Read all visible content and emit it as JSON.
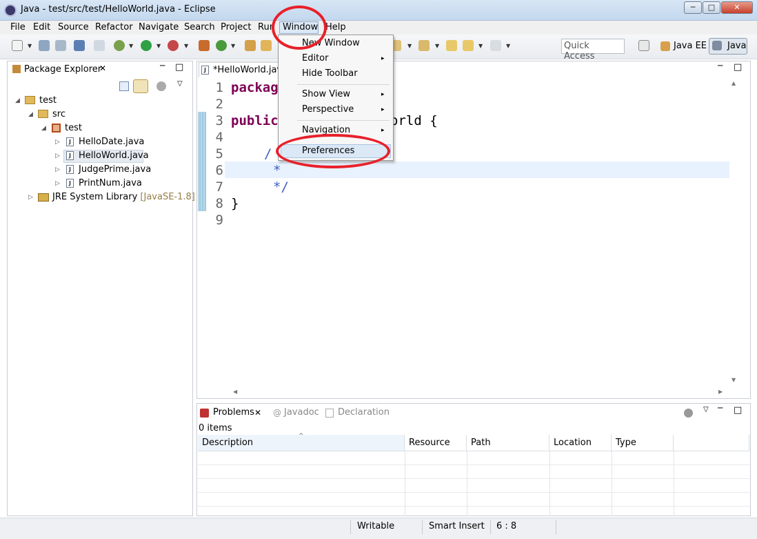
{
  "window": {
    "title": "Java - test/src/test/HelloWorld.java - Eclipse",
    "minimize": "─",
    "maximize": "□",
    "close": "✕"
  },
  "menubar": [
    "File",
    "Edit",
    "Source",
    "Refactor",
    "Navigate",
    "Search",
    "Project",
    "Run",
    "Window",
    "Help"
  ],
  "toolbar": {
    "quick_access_placeholder": "Quick Access",
    "perspective_javaee": "Java EE",
    "perspective_java": "Java"
  },
  "package_explorer": {
    "tab_label": "Package Explorer",
    "tree": {
      "project": "test",
      "src": "src",
      "package": "test",
      "files": [
        "HelloDate.java",
        "HelloWorld.java",
        "JudgePrime.java",
        "PrintNum.java"
      ],
      "jre_label": "JRE System Library",
      "jre_version": "[JavaSE-1.8]"
    }
  },
  "editor": {
    "tab_label": "*HelloWorld.java",
    "line_numbers": [
      "1",
      "2",
      "3",
      "4",
      "5",
      "6",
      "7",
      "8",
      "9"
    ],
    "lines": {
      "l1_kw": "packag",
      "l3_kw": "public",
      "l3_rest": "orld {",
      "l5": "/",
      "l6": "*",
      "l7": "*/",
      "l8": "}"
    }
  },
  "window_menu": {
    "items": [
      "New Window",
      "Editor",
      "Hide Toolbar",
      "Show View",
      "Perspective",
      "Navigation",
      "Preferences"
    ],
    "submenu_arrow": "▸"
  },
  "bottom_panel": {
    "tabs": [
      "Problems",
      "Javadoc",
      "Declaration"
    ],
    "items_count": "0 items",
    "columns": [
      "Description",
      "Resource",
      "Path",
      "Location",
      "Type"
    ]
  },
  "status_bar": {
    "writable": "Writable",
    "insert_mode": "Smart Insert",
    "position": "6 : 8"
  },
  "colors": {
    "annotation_circle": "#e8202a",
    "keyword": "#7f0055",
    "comment": "#3f5fbf"
  }
}
